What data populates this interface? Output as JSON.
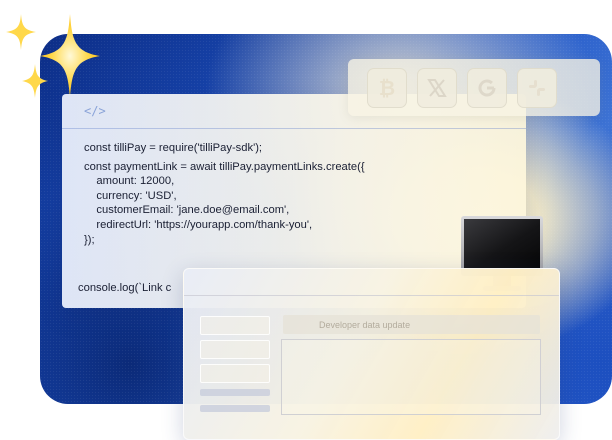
{
  "code_window": {
    "tag": "</>",
    "lines": [
      "const tilliPay = require('tilliPay-sdk');",
      "",
      "const paymentLink = await tilliPay.paymentLinks.create({",
      "    amount: 12000,",
      "    currency: 'USD',",
      "    customerEmail: 'jane.doe@email.com',",
      "    redirectUrl: 'https://yourapp.com/thank-you',",
      "});"
    ],
    "log": "console.log(`Link c"
  },
  "logos": [
    "bitcoin-icon",
    "x-icon",
    "google-icon",
    "slack-icon"
  ],
  "dashboard": {
    "title": "Developer data update"
  },
  "colors": {
    "background_deep": "#0c2d86",
    "background_bright": "#3e73d4",
    "glow": "#fff4d2",
    "sparkle": "#ffd84a"
  }
}
